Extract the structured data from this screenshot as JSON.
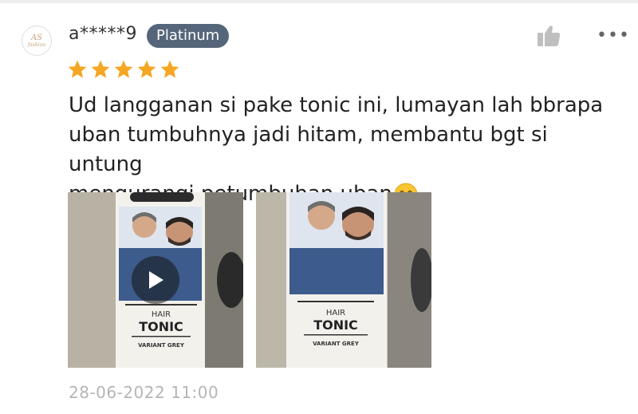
{
  "review": {
    "avatar_monogram": "AS",
    "avatar_sub": "fashion",
    "username": "a*****9",
    "badge": "Platinum",
    "rating": 5,
    "text_lines": [
      "Ud langganan si pake tonic ini, lumayan lah bbrapa",
      "uban tumbuhnya jadi hitam, membantu bgt si untung",
      "mengurangi petumbuhan uban"
    ],
    "timestamp": "28-06-2022 11:00"
  },
  "media": [
    {
      "type": "video",
      "product_small": "HAIR",
      "product_name": "TONIC",
      "product_variant": "VARIANT GREY"
    },
    {
      "type": "image",
      "product_small": "HAIR",
      "product_name": "TONIC",
      "product_variant": "VARIANT GREY"
    }
  ],
  "icons": {
    "like": "thumbs-up-icon",
    "more": "more-icon",
    "star": "star-icon",
    "emoji": "smiling-face-icon",
    "play": "play-icon"
  },
  "colors": {
    "badge_bg": "#55657a",
    "star": "#f5a623",
    "timestamp": "#b5b5b5",
    "icon_grey": "#bfbfbf"
  }
}
